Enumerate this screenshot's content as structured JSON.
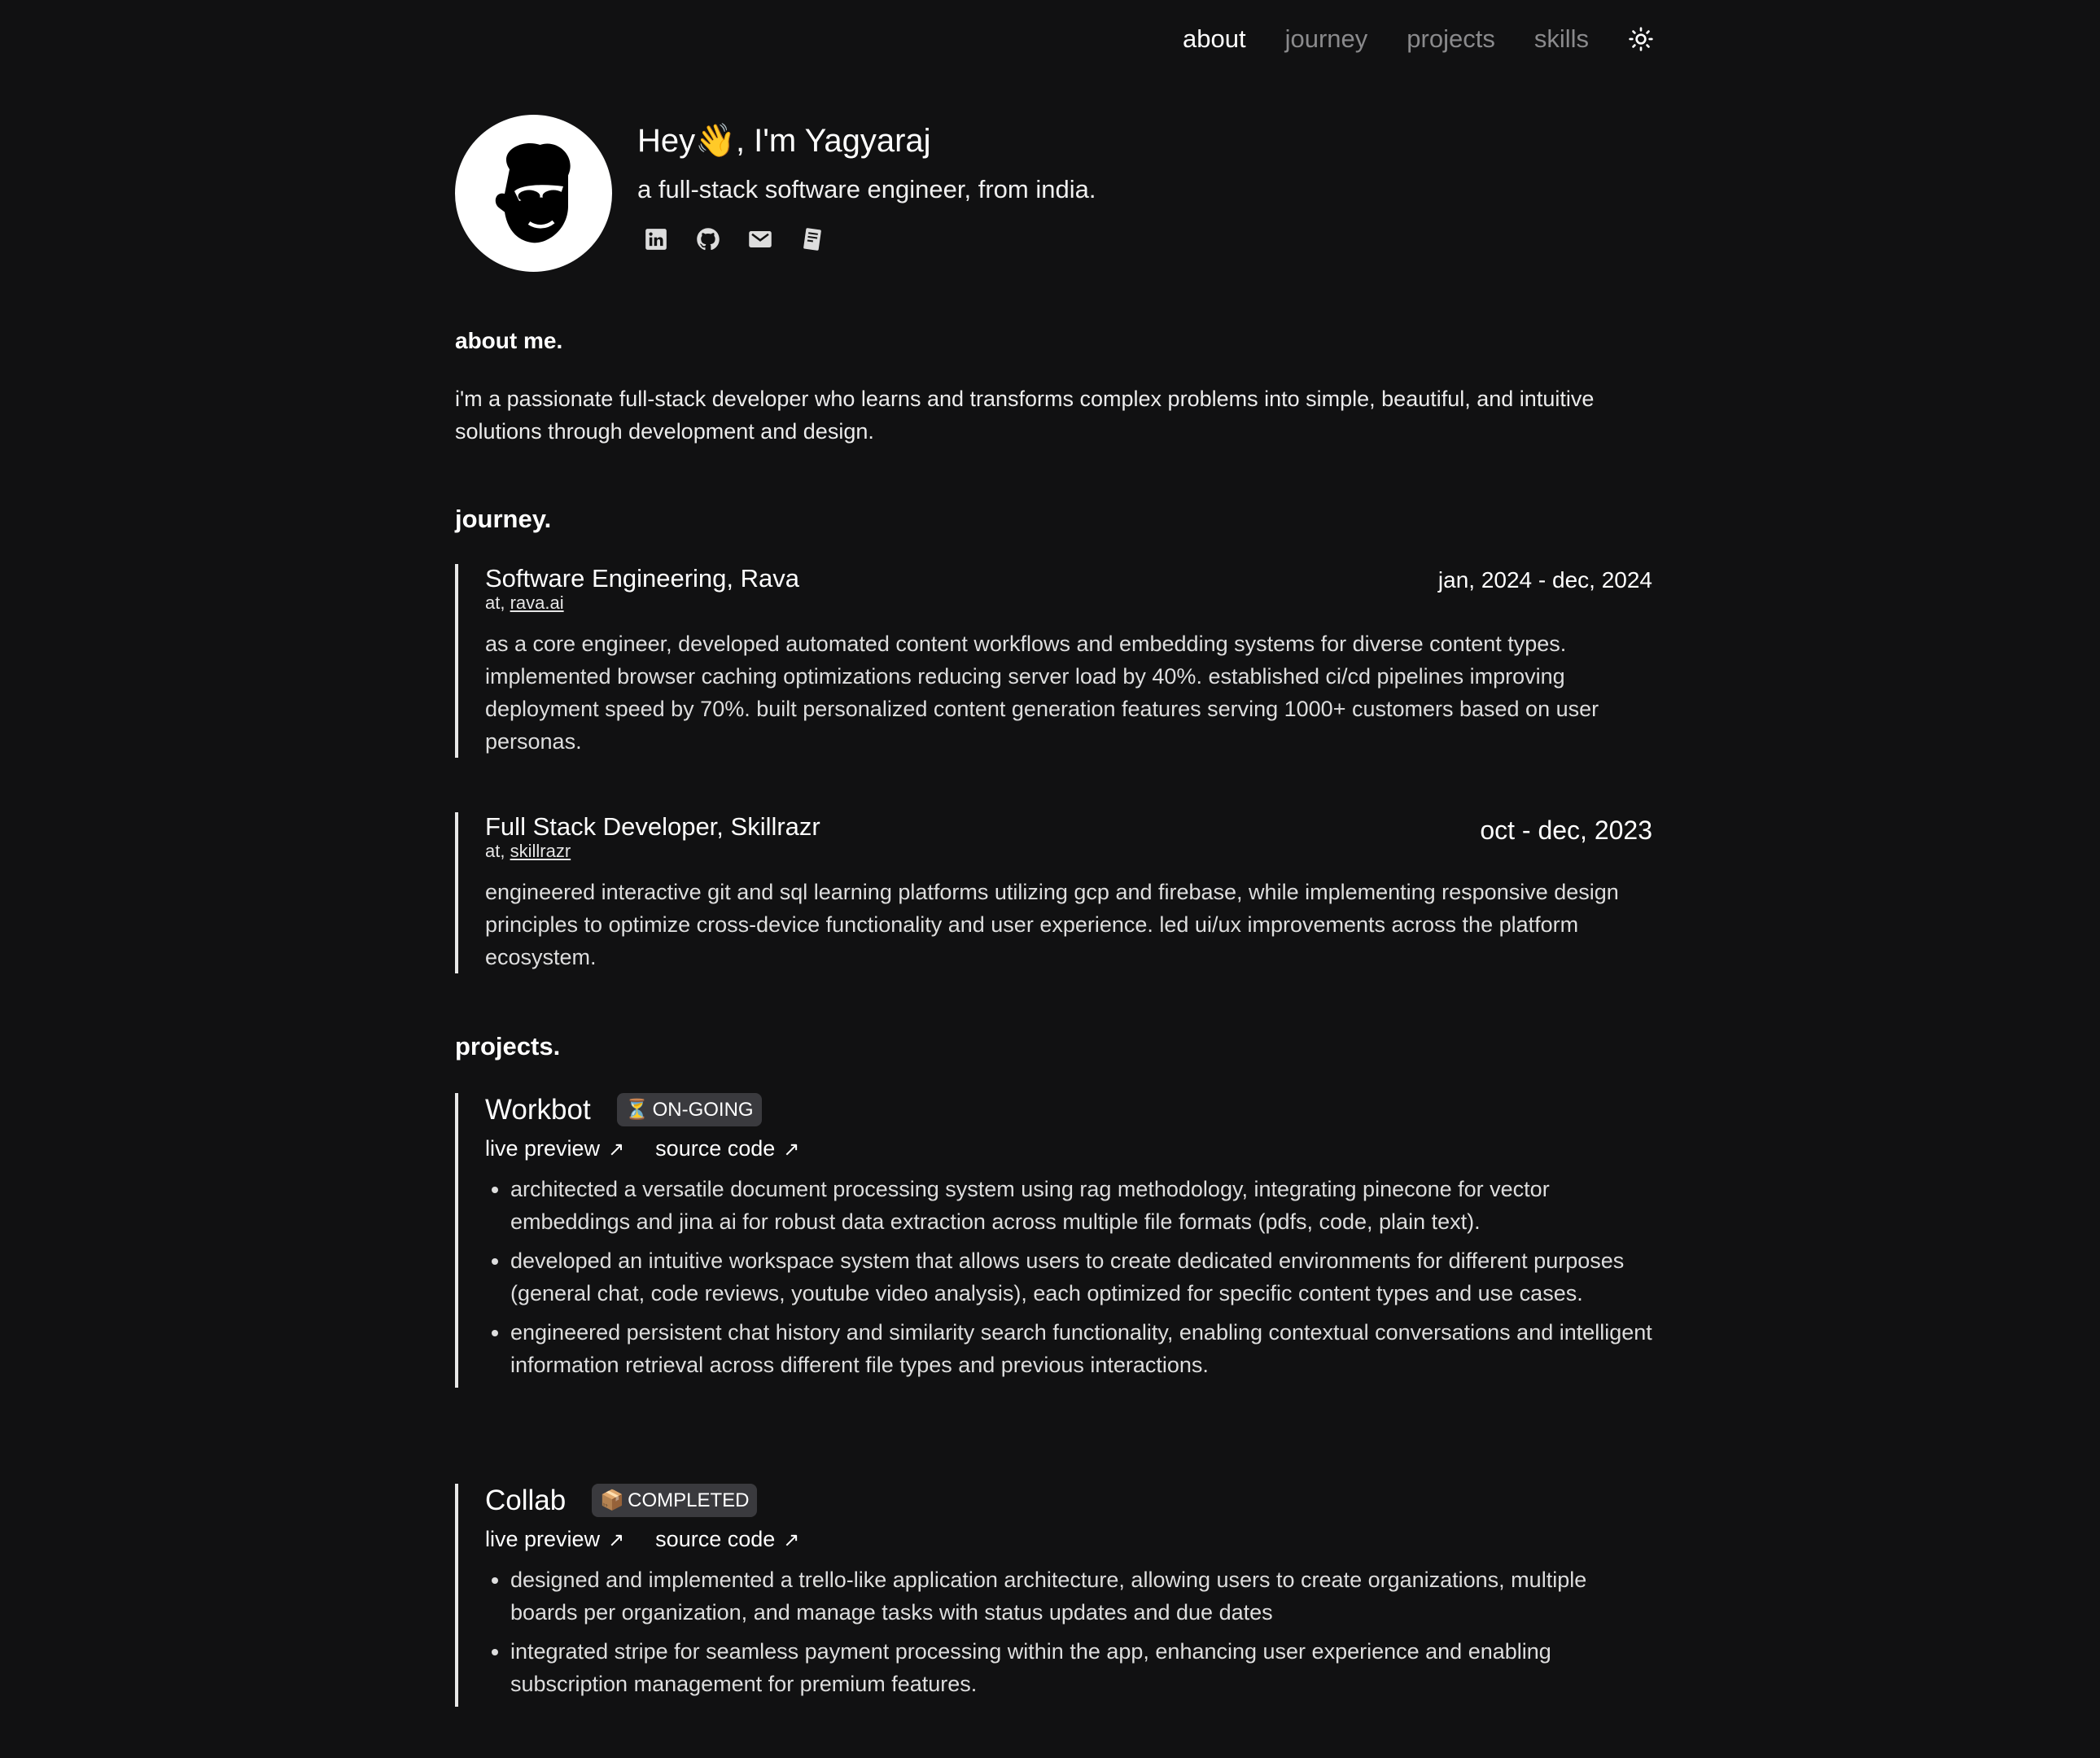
{
  "nav": {
    "items": [
      {
        "label": "about",
        "active": true
      },
      {
        "label": "journey",
        "active": false
      },
      {
        "label": "projects",
        "active": false
      },
      {
        "label": "skills",
        "active": false
      }
    ],
    "theme_icon": "sun-icon"
  },
  "hero": {
    "greeting_pre": "Hey",
    "wave_emoji": "👋",
    "greeting_post": ", I'm Yagyaraj",
    "tagline": "a full-stack software engineer, from india.",
    "socials": [
      "linkedin-icon",
      "github-icon",
      "mail-icon",
      "resume-icon"
    ]
  },
  "about": {
    "heading": "about me.",
    "text": "i'm a passionate full-stack developer who learns and transforms complex problems into simple, beautiful, and intuitive solutions through development and design."
  },
  "journey": {
    "heading": "journey.",
    "entries": [
      {
        "title": "Software Engineering, Rava",
        "at_prefix": "at,",
        "company": "rava.ai",
        "date": "jan, 2024 - dec, 2024",
        "description": "as a core engineer, developed automated content workflows and embedding systems for diverse content types. implemented browser caching optimizations reducing server load by 40%. established ci/cd pipelines improving deployment speed by 70%. built personalized content generation features serving 1000+ customers based on user personas."
      },
      {
        "title": "Full Stack Developer, Skillrazr",
        "at_prefix": "at,",
        "company": "skillrazr",
        "date": "oct - dec, 2023",
        "description": "engineered interactive git and sql learning platforms utilizing gcp and firebase, while implementing responsive design principles to optimize cross-device functionality and user experience. led ui/ux improvements across the platform ecosystem."
      }
    ]
  },
  "projects": {
    "heading": "projects.",
    "live_label": "live preview",
    "source_label": "source code",
    "arrow": "↗",
    "items": [
      {
        "name": "Workbot",
        "badge_emoji": "⏳",
        "badge": "ON-GOING",
        "bullets": [
          "architected a versatile document processing system using rag methodology, integrating pinecone for vector embeddings and jina ai for robust data extraction across multiple file formats (pdfs, code, plain text).",
          "developed an intuitive workspace system that allows users to create dedicated environments for different purposes (general chat, code reviews, youtube video analysis), each optimized for specific content types and use cases.",
          "engineered persistent chat history and similarity search functionality, enabling contextual conversations and intelligent information retrieval across different file types and previous interactions."
        ]
      },
      {
        "name": "Collab",
        "badge_emoji": "📦",
        "badge": "COMPLETED",
        "bullets": [
          "designed and implemented a trello-like application architecture, allowing users to create organizations, multiple boards per organization, and manage tasks with status updates and due dates",
          "integrated stripe for seamless payment processing within the app, enhancing user experience and enabling subscription management for premium features."
        ]
      }
    ]
  }
}
